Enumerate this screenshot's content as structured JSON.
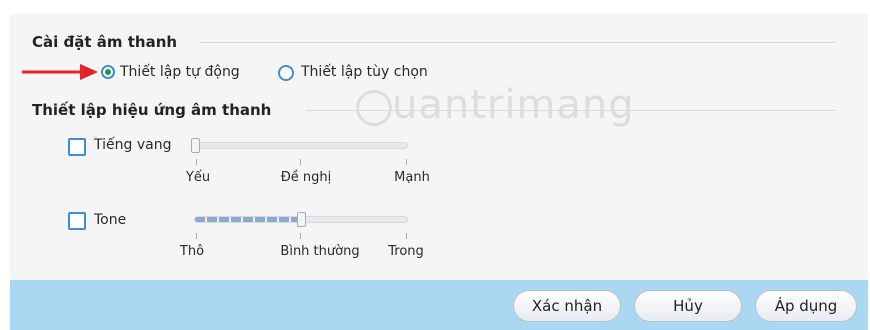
{
  "audio_settings": {
    "title": "Cài đặt âm thanh",
    "options": [
      {
        "label": "Thiết lập tự động",
        "selected": true
      },
      {
        "label": "Thiết lập tùy chọn",
        "selected": false
      }
    ]
  },
  "effects": {
    "title": "Thiết lập hiệu ứng âm thanh",
    "echo": {
      "label": "Tiếng vang",
      "checked": false,
      "value": 0,
      "scale": [
        "Yếu",
        "Đề nghị",
        "Mạnh"
      ]
    },
    "tone": {
      "label": "Tone",
      "checked": false,
      "value": 0.5,
      "scale": [
        "Thô",
        "Bình thường",
        "Trong"
      ]
    }
  },
  "watermark": "uantrimang",
  "footer": {
    "confirm_label": "Xác nhận",
    "cancel_label": "Hủy",
    "apply_label": "Áp dụng"
  },
  "colors": {
    "accent": "#3b8fd4",
    "radio_selected": "#1a9a3a",
    "footer_bg": "#aad7f2",
    "arrow": "#e8202a"
  }
}
